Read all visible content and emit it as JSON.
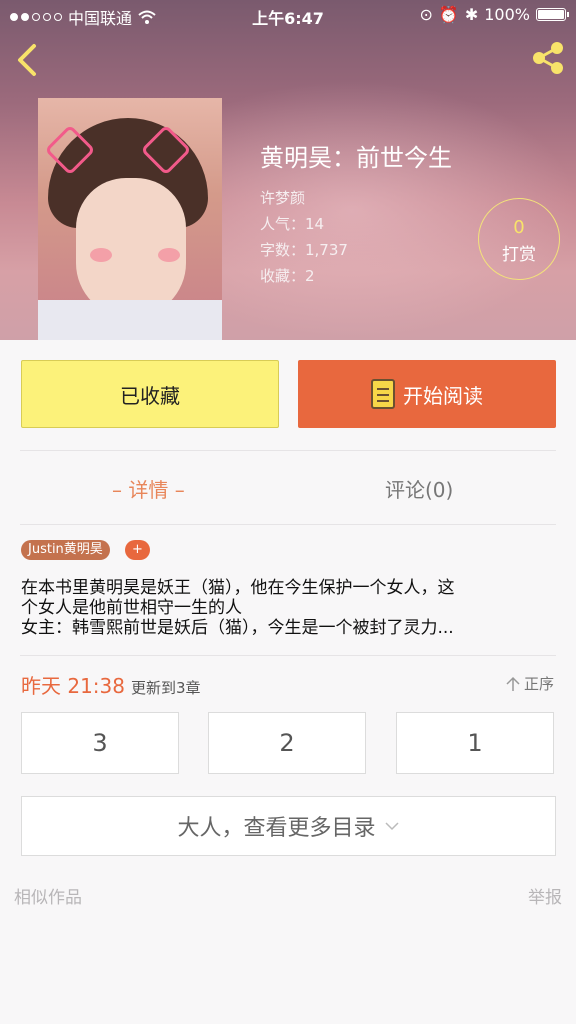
{
  "status_bar": {
    "carrier": "中国联通",
    "time": "上午6:47",
    "battery": "100%"
  },
  "book": {
    "title": "黄明昊：前世今生",
    "author": "许梦颜",
    "popularity": "人气：14",
    "word_count": "字数：1,737",
    "favorites": "收藏：2"
  },
  "reward": {
    "count": "0",
    "label": "打赏"
  },
  "actions": {
    "favorited_label": "已收藏",
    "read_label": "开始阅读"
  },
  "tabs": {
    "detail": "– 详情 –",
    "comments": "评论(0)"
  },
  "tags": {
    "name": "Justin黄明昊",
    "add": "+"
  },
  "description": {
    "line1": "在本书里黄明昊是妖王（猫），他在今生保护一个女人，这",
    "line2": "个女人是他前世相守一生的人",
    "line3": "女主：韩雪熙前世是妖后（猫），今生是一个被封了灵力..."
  },
  "update": {
    "time": "昨天 21:38",
    "text": "更新到3章",
    "sort_label": "正序"
  },
  "chapters": [
    "3",
    "2",
    "1"
  ],
  "more_label": "大人，查看更多目录",
  "footer": {
    "similar": "相似作品",
    "report": "举报"
  },
  "colors": {
    "accent": "#e8683e",
    "favorite_button": "#fcf27a",
    "reward_number": "#f8e36a"
  }
}
